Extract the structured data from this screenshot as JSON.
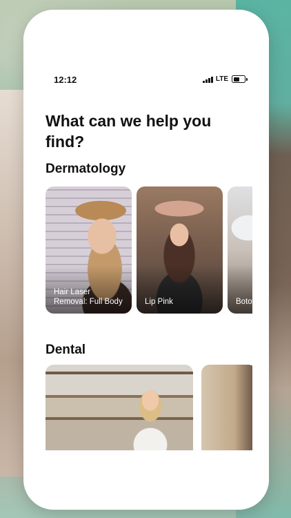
{
  "status_bar": {
    "time": "12:12",
    "network": "LTE"
  },
  "headline": "What can we help you find?",
  "sections": [
    {
      "title": "Dermatology",
      "cards": [
        {
          "label": "Hair Laser Removal: Full Body"
        },
        {
          "label": "Lip Pink"
        },
        {
          "label": "Botox"
        }
      ]
    },
    {
      "title": "Dental",
      "cards": [
        {
          "label": ""
        },
        {
          "label": ""
        }
      ]
    }
  ],
  "colors": {
    "background_teal": "#56b3a2",
    "text_primary": "#111111",
    "card_label": "#ffffff"
  }
}
